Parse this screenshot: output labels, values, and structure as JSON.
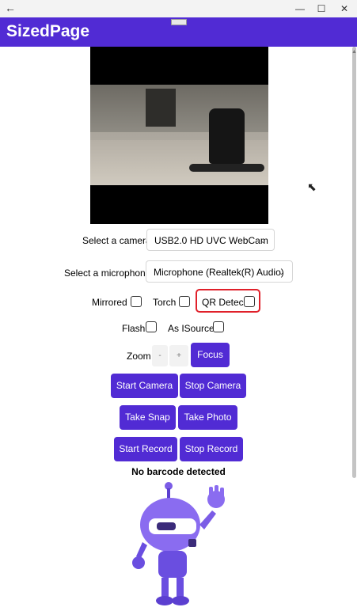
{
  "app": {
    "title": "SizedPage"
  },
  "titlebar": {
    "back_glyph": "←",
    "minimize_glyph": "—",
    "maximize_glyph": "☐",
    "close_glyph": "✕"
  },
  "camera": {
    "label": "Select a camera:",
    "selected": "USB2.0 HD UVC WebCam"
  },
  "microphone": {
    "label": "Select a microphone:",
    "selected": "Microphone (Realtek(R) Audio)"
  },
  "options": {
    "mirrored": {
      "label": "Mirrored",
      "checked": false
    },
    "torch": {
      "label": "Torch",
      "checked": false
    },
    "qr": {
      "label": "QR Detec.",
      "checked": false
    },
    "flash": {
      "label": "Flash",
      "checked": false
    },
    "isource": {
      "label": "As ISource",
      "checked": false
    }
  },
  "zoom": {
    "label": "Zoom",
    "minus": "-",
    "plus": "+",
    "focus": "Focus"
  },
  "buttons": {
    "start_camera": "Start Camera",
    "stop_camera": "Stop Camera",
    "take_snap": "Take Snap",
    "take_photo": "Take Photo",
    "start_record": "Start Record",
    "stop_record": "Stop Record"
  },
  "status": "No barcode detected",
  "colors": {
    "accent": "#512bd4",
    "highlight": "#e0202a"
  },
  "icons": {
    "back": "back-arrow-icon",
    "dropdown": "chevron-down-icon",
    "cursor": "mouse-pointer-icon",
    "mascot": "dotnet-bot-image"
  }
}
